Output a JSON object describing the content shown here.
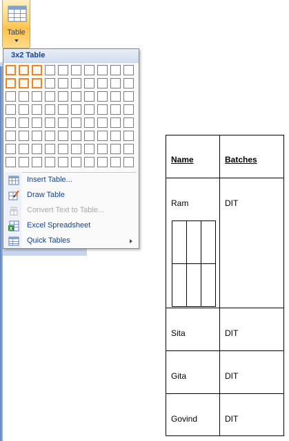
{
  "ribbon": {
    "table_button_label": "Table",
    "table_button_icon": "table-grid-icon"
  },
  "dropdown": {
    "header": "3x2 Table",
    "grid_cols": 10,
    "grid_rows": 8,
    "selected_cols": 3,
    "selected_rows": 2,
    "menu": [
      {
        "label": "Insert Table...",
        "icon": "insert-table-icon",
        "enabled": true,
        "submenu": false
      },
      {
        "label": "Draw Table",
        "icon": "draw-table-icon",
        "enabled": true,
        "submenu": false
      },
      {
        "label": "Convert Text to Table...",
        "icon": "convert-text-icon",
        "enabled": false,
        "submenu": false
      },
      {
        "label": "Excel Spreadsheet",
        "icon": "excel-spreadsheet-icon",
        "enabled": true,
        "submenu": false
      },
      {
        "label": "Quick Tables",
        "icon": "quick-tables-icon",
        "enabled": true,
        "submenu": true
      }
    ]
  },
  "document_table": {
    "headers": [
      "Name",
      "Batches"
    ],
    "rows": [
      [
        "Ram",
        "DIT"
      ],
      [
        "Sita",
        "DIT"
      ],
      [
        "Gita",
        "DIT"
      ],
      [
        "Govind",
        "DIT"
      ]
    ],
    "nested_table": {
      "cols": 3,
      "rows": 2
    }
  },
  "colors": {
    "accent": "#15428b",
    "selection": "#ef8426",
    "button_highlight": "#ffc24a"
  }
}
